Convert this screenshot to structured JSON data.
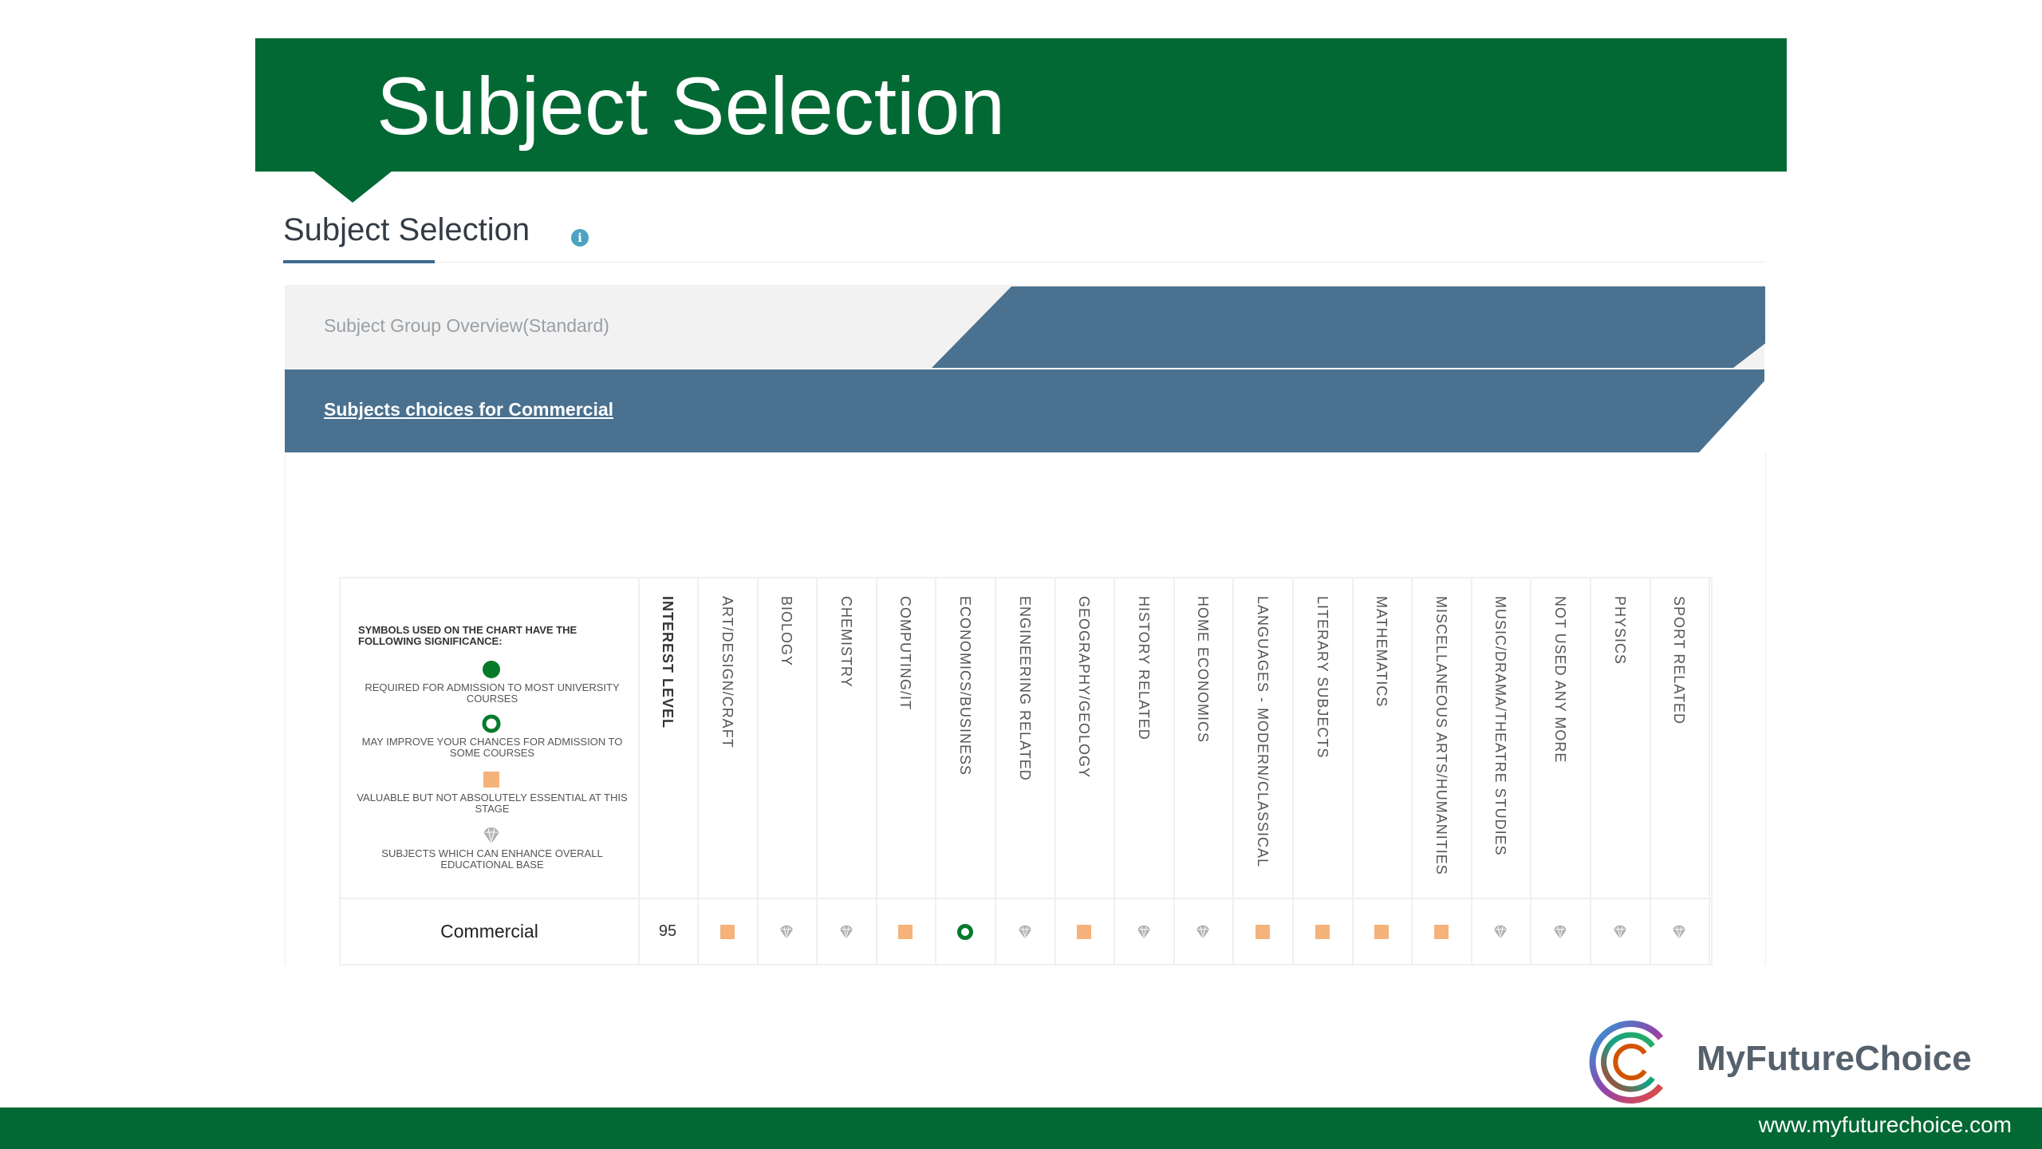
{
  "slide": {
    "title": "Subject Selection",
    "footer_url": "www.myfuturechoice.com",
    "logo_text": "MyFutureChoice"
  },
  "section": {
    "title": "Subject Selection",
    "info_icon": "i"
  },
  "tabs": {
    "standard_label": "Subject Group Overview(Standard)",
    "commercial_link": "Subjects choices for Commercial"
  },
  "legend": {
    "heading": "SYMBOLS USED ON THE CHART HAVE THE FOLLOWING SIGNIFICANCE:",
    "items": [
      {
        "icon": "filled-green-circle-icon",
        "text": "REQUIRED FOR ADMISSION TO MOST UNIVERSITY COURSES"
      },
      {
        "icon": "green-ring-icon",
        "text": "MAY IMPROVE YOUR CHANCES FOR ADMISSION TO SOME COURSES"
      },
      {
        "icon": "orange-square-icon",
        "text": "VALUABLE BUT NOT ABSOLUTELY ESSENTIAL AT THIS STAGE"
      },
      {
        "icon": "grey-diamond-icon",
        "text": "SUBJECTS WHICH CAN ENHANCE OVERALL EDUCATIONAL BASE"
      }
    ]
  },
  "table": {
    "columns": [
      "INTEREST LEVEL",
      "ART/DESIGN/CRAFT",
      "BIOLOGY",
      "CHEMISTRY",
      "COMPUTING/IT",
      "ECONOMICS/BUSINESS",
      "ENGINEERING RELATED",
      "GEOGRAPHY/GEOLOGY",
      "HISTORY RELATED",
      "HOME ECONOMICS",
      "LANGUAGES - MODERN/CLASSICAL",
      "LITERARY SUBJECTS",
      "MATHEMATICS",
      "MISCELLANEOUS ARTS/HUMANITIES",
      "MUSIC/DRAMA/THEATRE STUDIES",
      "NOT USED ANY MORE",
      "PHYSICS",
      "SPORT RELATED"
    ],
    "row": {
      "label": "Commercial",
      "interest_level": "95",
      "symbols": [
        "square",
        "diamond",
        "diamond",
        "square",
        "ring",
        "diamond",
        "square",
        "diamond",
        "diamond",
        "square",
        "square",
        "square",
        "square",
        "diamond",
        "diamond",
        "diamond",
        "diamond"
      ]
    }
  },
  "colors": {
    "brand_green": "#036934",
    "tab_blue": "#4a718f",
    "symbol_green": "#067a2b",
    "symbol_orange": "#f5b27a",
    "symbol_grey": "#b9b9b9"
  }
}
